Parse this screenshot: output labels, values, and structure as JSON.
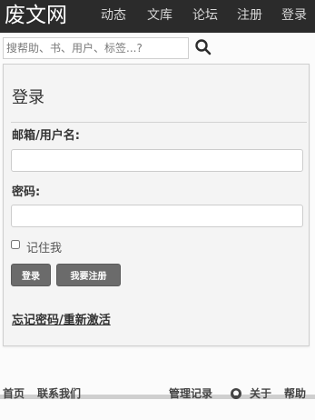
{
  "navbar": {
    "brand": "废文网",
    "items": [
      "动态",
      "文库",
      "论坛",
      "注册",
      "登录"
    ]
  },
  "search": {
    "placeholder": "搜帮助、书、用户、标签...?"
  },
  "login": {
    "title": "登录",
    "email_label": "邮箱/用户名:",
    "password_label": "密码:",
    "remember_label": "记住我",
    "login_button": "登录",
    "register_button": "我要注册",
    "forgot_link": "忘记密码/重新激活"
  },
  "footer": {
    "home": "首页",
    "contact": "联系我们",
    "admin_log": "管理记录",
    "github_icon": "github-icon",
    "about": "关于",
    "help": "帮助"
  },
  "colors": {
    "navbar_bg": "#2b2b2b",
    "button_bg": "#6b6b6b"
  }
}
